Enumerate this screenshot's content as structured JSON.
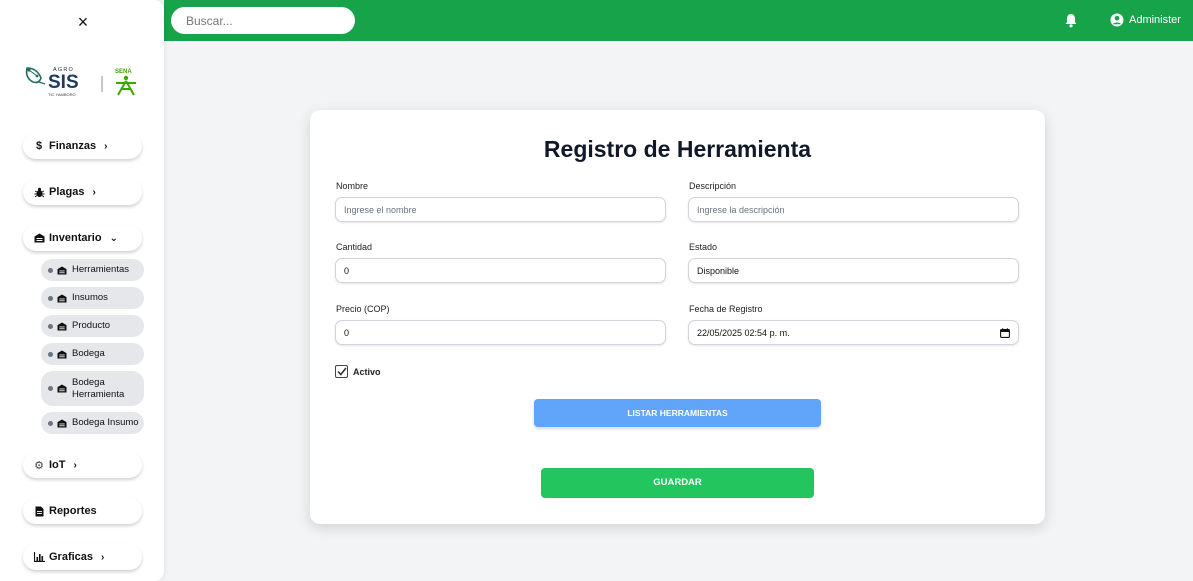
{
  "sidebar": {
    "close_label": "×",
    "logo": {
      "agro_top": "AGRO",
      "sis": "SIS",
      "sub": "TIC YAMBORÓ",
      "sena": "SENA"
    },
    "nav": {
      "finanzas": "Finanzas",
      "plagas": "Plagas",
      "inventario": "Inventario",
      "iot": "IoT",
      "reportes": "Reportes",
      "graficas": "Graficas"
    },
    "inventario_items": [
      {
        "label": "Herramientas"
      },
      {
        "label": "Insumos"
      },
      {
        "label": "Producto"
      },
      {
        "label": "Bodega"
      },
      {
        "label": "Bodega Herramienta"
      },
      {
        "label": "Bodega Insumo"
      }
    ]
  },
  "header": {
    "search_placeholder": "Buscar...",
    "user_name": "Administer",
    "icons": [
      "bell-icon",
      "user-circle-icon"
    ]
  },
  "form": {
    "title": "Registro de Herramienta",
    "nombre": {
      "label": "Nombre",
      "placeholder": "Ingrese el nombre"
    },
    "descripcion": {
      "label": "Descripción",
      "placeholder": "Ingrese la descripción"
    },
    "cantidad": {
      "label": "Cantidad",
      "value": "0"
    },
    "estado": {
      "label": "Estado",
      "value": "Disponible"
    },
    "precio": {
      "label": "Precio (COP)",
      "value": "0"
    },
    "fecha": {
      "label": "Fecha de Registro",
      "value": "22/05/2025 02:54 p. m."
    },
    "activo": {
      "label": "Activo",
      "checked": true
    },
    "list_button": "LISTAR HERRAMIENTAS",
    "save_button": "GUARDAR"
  },
  "colors": {
    "header_green": "#16a34a",
    "save_green": "#22c55e",
    "list_blue": "#60a5fa",
    "sena_green": "#39a900"
  }
}
